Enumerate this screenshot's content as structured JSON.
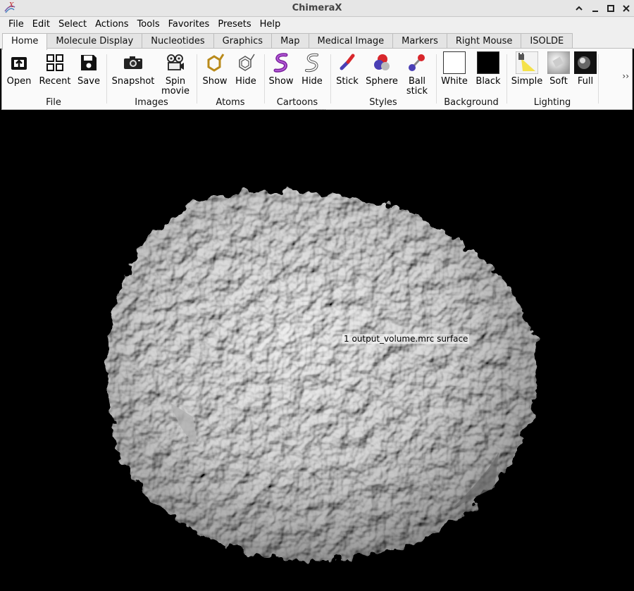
{
  "window": {
    "title": "ChimeraX"
  },
  "menu": [
    "File",
    "Edit",
    "Select",
    "Actions",
    "Tools",
    "Favorites",
    "Presets",
    "Help"
  ],
  "tabs": [
    "Home",
    "Molecule Display",
    "Nucleotides",
    "Graphics",
    "Map",
    "Medical Image",
    "Markers",
    "Right Mouse",
    "ISOLDE"
  ],
  "active_tab": "Home",
  "toolbar": {
    "file": {
      "label": "File",
      "open": "Open",
      "recent": "Recent",
      "save": "Save"
    },
    "images": {
      "label": "Images",
      "snapshot": "Snapshot",
      "spin": "Spin\nmovie"
    },
    "atoms": {
      "label": "Atoms",
      "show": "Show",
      "hide": "Hide"
    },
    "cartoons": {
      "label": "Cartoons",
      "show": "Show",
      "hide": "Hide"
    },
    "styles": {
      "label": "Styles",
      "stick": "Stick",
      "sphere": "Sphere",
      "ball": "Ball\nstick"
    },
    "background": {
      "label": "Background",
      "white": "White",
      "black": "Black"
    },
    "lighting": {
      "label": "Lighting",
      "simple": "Simple",
      "soft": "Soft",
      "full": "Full"
    },
    "more": "››"
  },
  "viewport": {
    "model_label": "1 output_volume.mrc surface",
    "background_color": "#000000",
    "surface_color": "#d9d9d9"
  }
}
